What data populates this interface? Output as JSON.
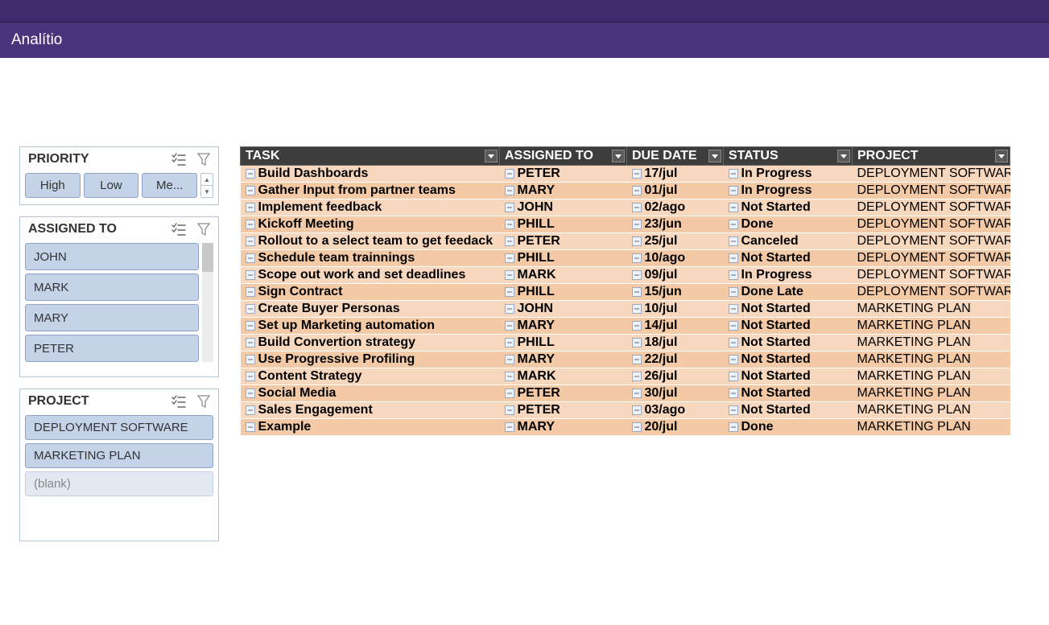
{
  "header": {
    "title": "Analítio"
  },
  "slicers": {
    "priority": {
      "title": "PRIORITY",
      "items": [
        "High",
        "Low",
        "Me..."
      ]
    },
    "assigned": {
      "title": "ASSIGNED TO",
      "items": [
        "JOHN",
        "MARK",
        "MARY",
        "PETER"
      ]
    },
    "project": {
      "title": "PROJECT",
      "items": [
        "DEPLOYMENT SOFTWARE",
        "MARKETING PLAN"
      ],
      "blank": "(blank)"
    }
  },
  "columns": {
    "task": "TASK",
    "assigned": "ASSIGNED TO",
    "due": "DUE DATE",
    "status": "STATUS",
    "project": "PROJECT"
  },
  "rows": [
    {
      "task": "Build Dashboards",
      "assigned": "PETER",
      "due": "17/jul",
      "status": "In Progress",
      "project": "DEPLOYMENT SOFTWARE",
      "alt": false
    },
    {
      "task": "Gather Input from partner teams",
      "assigned": "MARY",
      "due": "01/jul",
      "status": "In Progress",
      "project": "DEPLOYMENT SOFTWARE",
      "alt": true
    },
    {
      "task": "Implement feedback",
      "assigned": "JOHN",
      "due": "02/ago",
      "status": "Not Started",
      "project": "DEPLOYMENT SOFTWARE",
      "alt": false
    },
    {
      "task": "Kickoff Meeting",
      "assigned": "PHILL",
      "due": "23/jun",
      "status": "Done",
      "project": "DEPLOYMENT SOFTWARE",
      "alt": true
    },
    {
      "task": "Rollout to a select team to get feedack",
      "assigned": "PETER",
      "due": "25/jul",
      "status": "Canceled",
      "project": "DEPLOYMENT SOFTWARE",
      "alt": false
    },
    {
      "task": "Schedule team trainnings",
      "assigned": "PHILL",
      "due": "10/ago",
      "status": "Not Started",
      "project": "DEPLOYMENT SOFTWARE",
      "alt": true
    },
    {
      "task": "Scope out work and set deadlines",
      "assigned": "MARK",
      "due": "09/jul",
      "status": "In Progress",
      "project": "DEPLOYMENT SOFTWARE",
      "alt": false
    },
    {
      "task": "Sign Contract",
      "assigned": "PHILL",
      "due": "15/jun",
      "status": "Done Late",
      "project": "DEPLOYMENT SOFTWARE",
      "alt": true
    },
    {
      "task": "Create Buyer Personas",
      "assigned": "JOHN",
      "due": "10/jul",
      "status": "Not Started",
      "project": "MARKETING PLAN",
      "alt": false
    },
    {
      "task": "Set up Marketing automation",
      "assigned": "MARY",
      "due": "14/jul",
      "status": "Not Started",
      "project": "MARKETING PLAN",
      "alt": true
    },
    {
      "task": "Build Convertion strategy",
      "assigned": "PHILL",
      "due": "18/jul",
      "status": "Not Started",
      "project": "MARKETING PLAN",
      "alt": false
    },
    {
      "task": "Use Progressive Profiling",
      "assigned": "MARY",
      "due": "22/jul",
      "status": "Not Started",
      "project": "MARKETING PLAN",
      "alt": true
    },
    {
      "task": "Content Strategy",
      "assigned": "MARK",
      "due": "26/jul",
      "status": "Not Started",
      "project": "MARKETING PLAN",
      "alt": false
    },
    {
      "task": "Social Media",
      "assigned": "PETER",
      "due": "30/jul",
      "status": "Not Started",
      "project": "MARKETING PLAN",
      "alt": true
    },
    {
      "task": "Sales Engagement",
      "assigned": "PETER",
      "due": "03/ago",
      "status": "Not Started",
      "project": "MARKETING PLAN",
      "alt": false
    },
    {
      "task": "Example",
      "assigned": "MARY",
      "due": "20/jul",
      "status": "Done",
      "project": "MARKETING PLAN",
      "alt": true
    }
  ]
}
